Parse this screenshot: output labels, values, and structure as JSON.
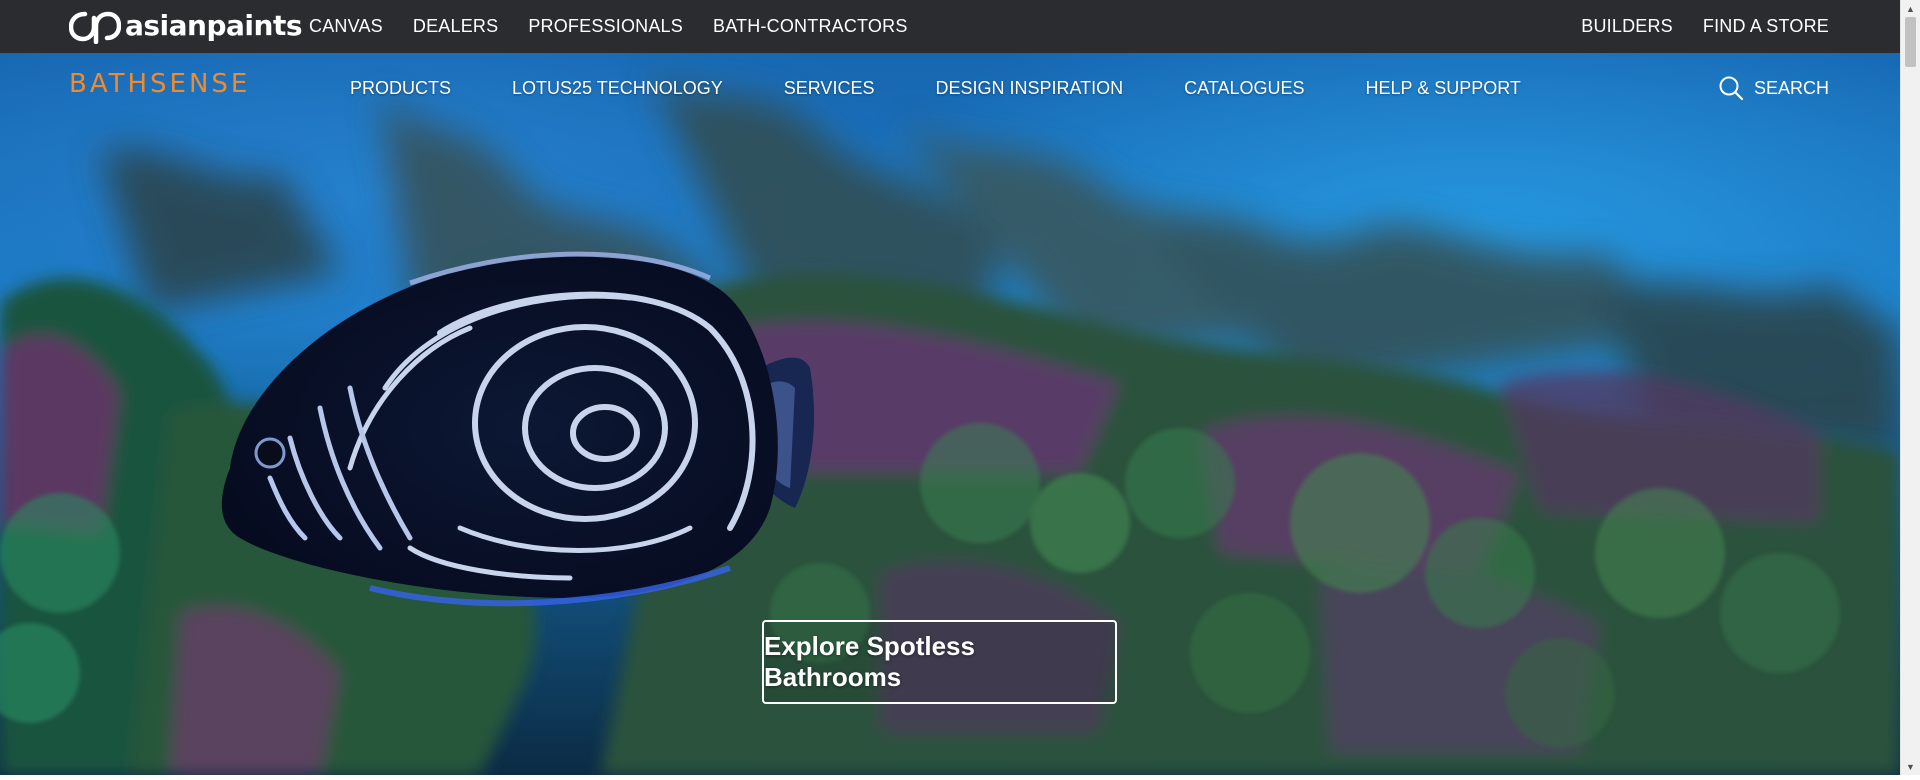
{
  "topbar": {
    "brand_logo_text": "asianpaints",
    "left_links": [
      {
        "label": "CANVAS"
      },
      {
        "label": "DEALERS"
      },
      {
        "label": "PROFESSIONALS"
      },
      {
        "label": "BATH-CONTRACTORS"
      }
    ],
    "right_links": [
      {
        "label": "BUILDERS"
      },
      {
        "label": "FIND A STORE"
      }
    ],
    "background_color": "#2b2c2f"
  },
  "subnav": {
    "brand": "BATHSENSE",
    "brand_color": "#f08a2c",
    "links": [
      {
        "label": "PRODUCTS"
      },
      {
        "label": "LOTUS25 TECHNOLOGY"
      },
      {
        "label": "SERVICES"
      },
      {
        "label": "DESIGN INSPIRATION"
      },
      {
        "label": "CATALOGUES"
      },
      {
        "label": "HELP & SUPPORT"
      }
    ],
    "search_label": "SEARCH",
    "search_icon": "search-icon"
  },
  "hero": {
    "image_subject": "emperor angelfish swimming over coral reef",
    "cta_label": "Explore Spotless Bathrooms"
  },
  "scrollbar": {
    "up_icon": "▲",
    "down_icon": "▼"
  }
}
